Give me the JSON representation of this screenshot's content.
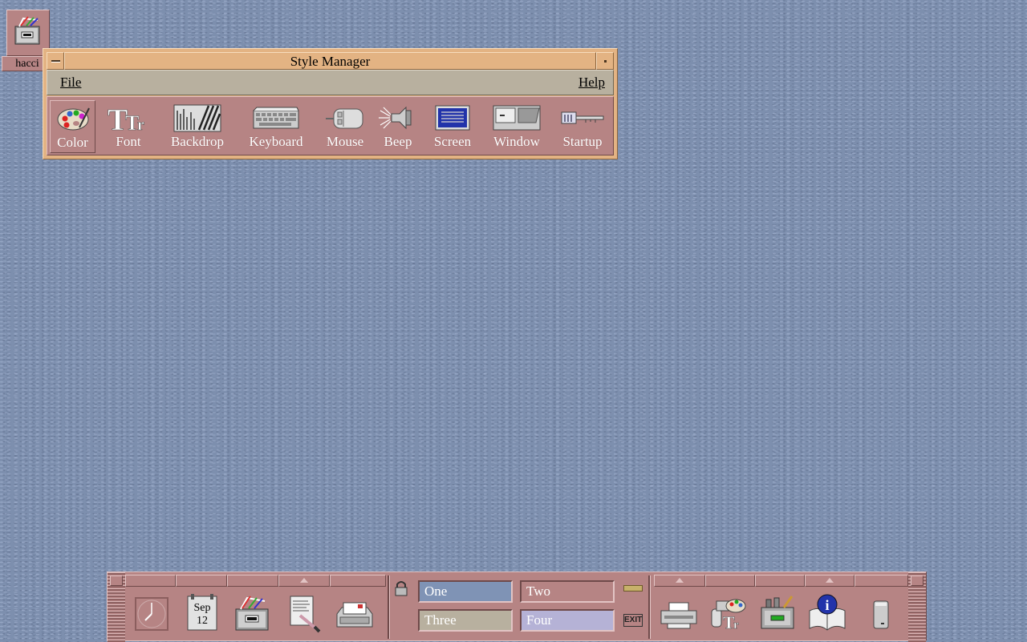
{
  "desktop": {
    "icon_label": "hacci"
  },
  "window": {
    "title": "Style Manager",
    "menus": [
      "File",
      "Help"
    ],
    "tools": [
      {
        "label": "Color",
        "icon": "palette-icon",
        "active": true
      },
      {
        "label": "Font",
        "icon": "font-icon"
      },
      {
        "label": "Backdrop",
        "icon": "backdrop-icon"
      },
      {
        "label": "Keyboard",
        "icon": "keyboard-icon"
      },
      {
        "label": "Mouse",
        "icon": "mouse-icon"
      },
      {
        "label": "Beep",
        "icon": "speaker-icon"
      },
      {
        "label": "Screen",
        "icon": "screen-icon"
      },
      {
        "label": "Window",
        "icon": "window-icon"
      },
      {
        "label": "Startup",
        "icon": "key-icon"
      }
    ]
  },
  "front_panel": {
    "calendar": {
      "month": "Sep",
      "day": "12"
    },
    "workspaces": [
      "One",
      "Two",
      "Three",
      "Four"
    ],
    "workspace_colors": [
      "#7f93b5",
      "#b68484",
      "#b8b09f",
      "#b5b2d6"
    ],
    "exit_label": "EXIT",
    "left_controls": [
      "clock-icon",
      "calendar-icon",
      "file-manager-icon",
      "text-editor-icon",
      "mailer-icon"
    ],
    "right_controls": [
      "printer-icon",
      "style-manager-icon",
      "application-manager-icon",
      "help-icon",
      "trash-icon"
    ]
  },
  "colors": {
    "desktop": "#7d8fae",
    "window_frame": "#e3b383",
    "menubar": "#b8b09f",
    "toolbar": "#b68484"
  }
}
